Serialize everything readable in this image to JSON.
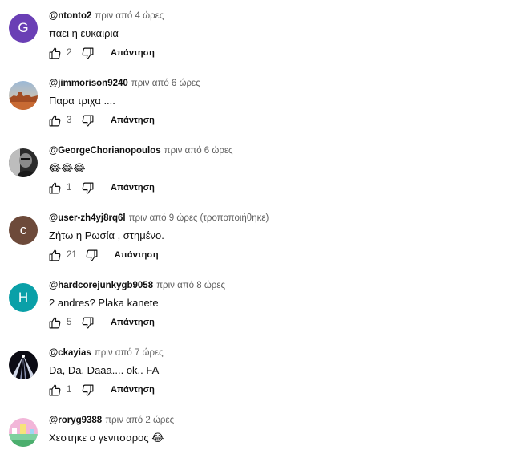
{
  "colors": {
    "text": "#0f0f0f",
    "muted": "#606060",
    "avatar_purple": "#6a3fb5",
    "avatar_brown": "#6d4a3a",
    "avatar_teal": "#0aa0a8"
  },
  "reply_label": "Απάντηση",
  "comments": [
    {
      "author": "@ntonto2",
      "time": "πριν από 4 ώρες",
      "edited": "",
      "text": "παει η ευκαιρια",
      "likes": "2",
      "avatar": {
        "type": "letter",
        "letter": "G",
        "color": "#6a3fb5"
      }
    },
    {
      "author": "@jimmorison9240",
      "time": "πριν από 6 ώρες",
      "edited": "",
      "text": "Παρα τριχα ....",
      "likes": "3",
      "avatar": {
        "type": "image",
        "icon": "desert-landscape-icon"
      }
    },
    {
      "author": "@GeorgeChorianopoulos",
      "time": "πριν από 6 ώρες",
      "edited": "",
      "text": "😂😂😂",
      "likes": "1",
      "avatar": {
        "type": "image",
        "icon": "portrait-photo-icon"
      }
    },
    {
      "author": "@user-zh4yj8rq6l",
      "time": "πριν από 9 ώρες",
      "edited": "(τροποποιήθηκε)",
      "text": "Ζήτω η Ρωσία , στημένο.",
      "likes": "21",
      "avatar": {
        "type": "letter",
        "letter": "c",
        "color": "#6d4a3a"
      }
    },
    {
      "author": "@hardcorejunkygb9058",
      "time": "πριν από 8 ώρες",
      "edited": "",
      "text": "2 andres? Plaka kanete",
      "likes": "5",
      "avatar": {
        "type": "letter",
        "letter": "H",
        "color": "#0aa0a8"
      }
    },
    {
      "author": "@ckayias",
      "time": "πριν από 7 ώρες",
      "edited": "",
      "text": "Da, Da, Daaa.... ok.. FA",
      "likes": "1",
      "avatar": {
        "type": "image",
        "icon": "light-rays-icon"
      }
    },
    {
      "author": "@roryg9388",
      "time": "πριν από 2 ώρες",
      "edited": "",
      "text": "Χεστηκε ο γενιτσαρος",
      "text_emoji": "😂",
      "likes": "",
      "avatar": {
        "type": "image",
        "icon": "pixel-landscape-icon"
      }
    }
  ]
}
